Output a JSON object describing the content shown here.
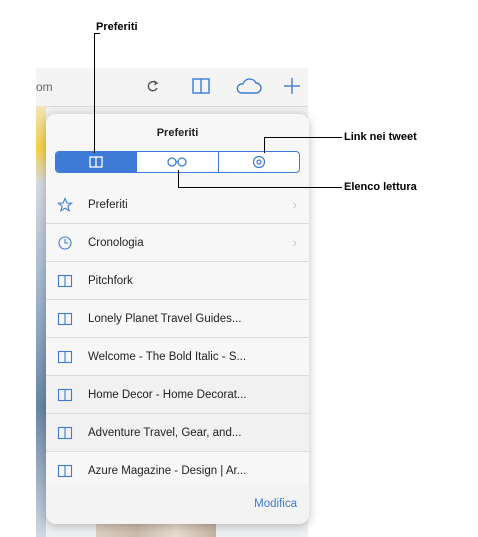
{
  "callouts": {
    "preferiti": "Preferiti",
    "link_tweet": "Link nei tweet",
    "elenco_lettura": "Elenco lettura"
  },
  "toolbar": {
    "url_fragment": "om",
    "icons": [
      "reload-icon",
      "book-icon",
      "cloud-icon",
      "plus-icon"
    ]
  },
  "popover": {
    "title": "Preferiti",
    "segments": [
      {
        "name": "segment-bookmarks",
        "icon": "book-icon",
        "active": true
      },
      {
        "name": "segment-reading-list",
        "icon": "glasses-icon",
        "active": false
      },
      {
        "name": "segment-shared-links",
        "icon": "at-icon",
        "active": false
      }
    ],
    "items": [
      {
        "label": "Preferiti",
        "icon": "star-icon",
        "chevron": true
      },
      {
        "label": "Cronologia",
        "icon": "clock-icon",
        "chevron": true
      },
      {
        "label": "Pitchfork",
        "icon": "book-icon",
        "chevron": false
      },
      {
        "label": "Lonely Planet Travel Guides...",
        "icon": "book-icon",
        "chevron": false
      },
      {
        "label": "Welcome - The Bold Italic - S...",
        "icon": "book-icon",
        "chevron": false
      },
      {
        "label": "Home Decor - Home Decorat...",
        "icon": "book-icon",
        "chevron": false
      },
      {
        "label": "Adventure Travel, Gear, and...",
        "icon": "book-icon",
        "chevron": false
      },
      {
        "label": "Azure Magazine - Design | Ar...",
        "icon": "book-icon",
        "chevron": false
      }
    ],
    "edit_label": "Modifica"
  },
  "colors": {
    "accent": "#3d7bd6",
    "background": "#ffffff"
  }
}
